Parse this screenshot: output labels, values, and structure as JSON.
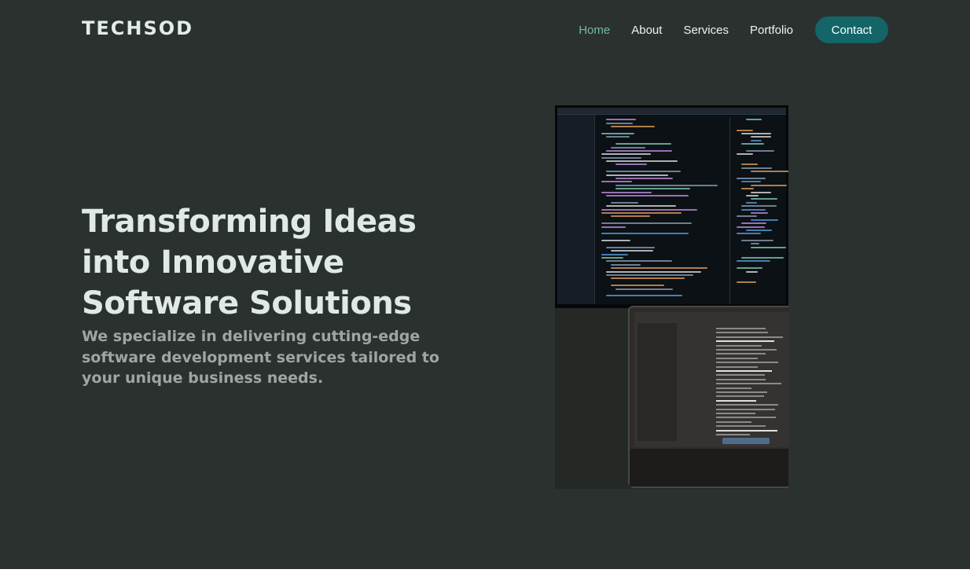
{
  "brand": {
    "logo_text": "TECHSOD"
  },
  "nav": {
    "items": [
      {
        "label": "Home",
        "active": true
      },
      {
        "label": "About"
      },
      {
        "label": "Services"
      },
      {
        "label": "Portfolio"
      }
    ],
    "contact_label": "Contact"
  },
  "hero": {
    "title": "Transforming Ideas into Innovative Software Solutions",
    "subtitle": "We specialize in delivering cutting-edge software development services tailored to your unique business needs."
  },
  "colors": {
    "background": "#2b312f",
    "accent": "#136567",
    "nav_active": "#6fb9a7",
    "title": "#dfeae5",
    "subtitle": "#9fa6a2"
  },
  "icons": {
    "hero_image": "code-editor-monitor-and-laptop-photo"
  }
}
